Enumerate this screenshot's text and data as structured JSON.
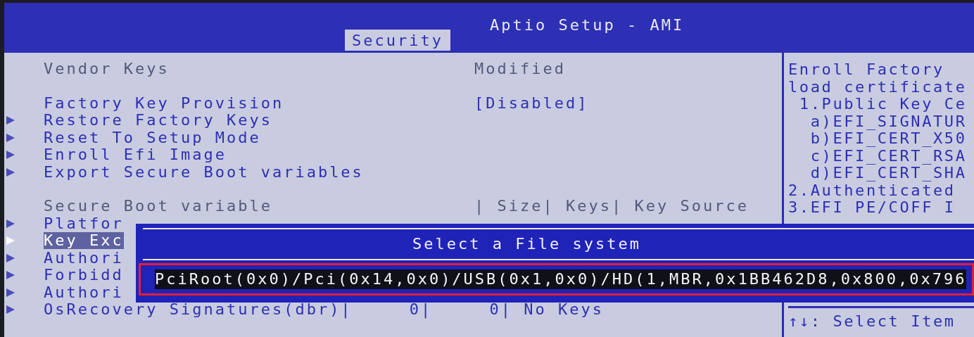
{
  "window": {
    "title": "Aptio Setup - AMI"
  },
  "tabs": [
    {
      "label": "Security",
      "selected": true
    }
  ],
  "groups": [
    [
      {
        "kind": "info",
        "label": "Vendor Keys",
        "value": "Modified",
        "selected": false
      }
    ],
    [
      {
        "kind": "setting",
        "label": "Factory Key Provision",
        "value": "[Disabled]",
        "selected": false
      },
      {
        "kind": "submenu",
        "label": "Restore Factory Keys",
        "selected": false
      },
      {
        "kind": "submenu",
        "label": "Reset To Setup Mode",
        "selected": false
      },
      {
        "kind": "submenu",
        "label": "Enroll Efi Image",
        "selected": false
      },
      {
        "kind": "submenu",
        "label": "Export Secure Boot variables",
        "selected": false
      }
    ],
    [
      {
        "kind": "info",
        "label": "Secure Boot variable",
        "value": "| Size| Keys| Key Source",
        "selected": false
      },
      {
        "kind": "submenu",
        "label": "Platfor",
        "selected": false
      },
      {
        "kind": "submenu",
        "label": "Key Exc",
        "selected": true
      },
      {
        "kind": "submenu",
        "label": "Authori",
        "selected": false
      },
      {
        "kind": "submenu",
        "label": "Forbidd",
        "selected": false
      },
      {
        "kind": "submenu",
        "label": "Authori",
        "selected": false
      },
      {
        "kind": "submenu",
        "label": "OsRecovery Signatures(dbr)|     0|     0| No Keys",
        "selected": false
      }
    ]
  ],
  "help": {
    "lines": [
      "Enroll Factory",
      "load certificate",
      " 1.Public Key Ce",
      "  a)EFI_SIGNATUR",
      "  b)EFI_CERT_X50",
      "  c)EFI_CERT_RSA",
      "  d)EFI_CERT_SHA",
      "2.Authenticated",
      "3.EFI PE/COFF I"
    ],
    "keys": [
      "↑↓: Select Item"
    ]
  },
  "dialog": {
    "title": "Select a File system",
    "options": [
      {
        "label": "PciRoot(0x0)/Pci(0x14,0x0)/USB(0x1,0x0)/HD(1,MBR,0x1BB462D8,0x800,0x796",
        "selected": true,
        "marked": true
      }
    ]
  }
}
